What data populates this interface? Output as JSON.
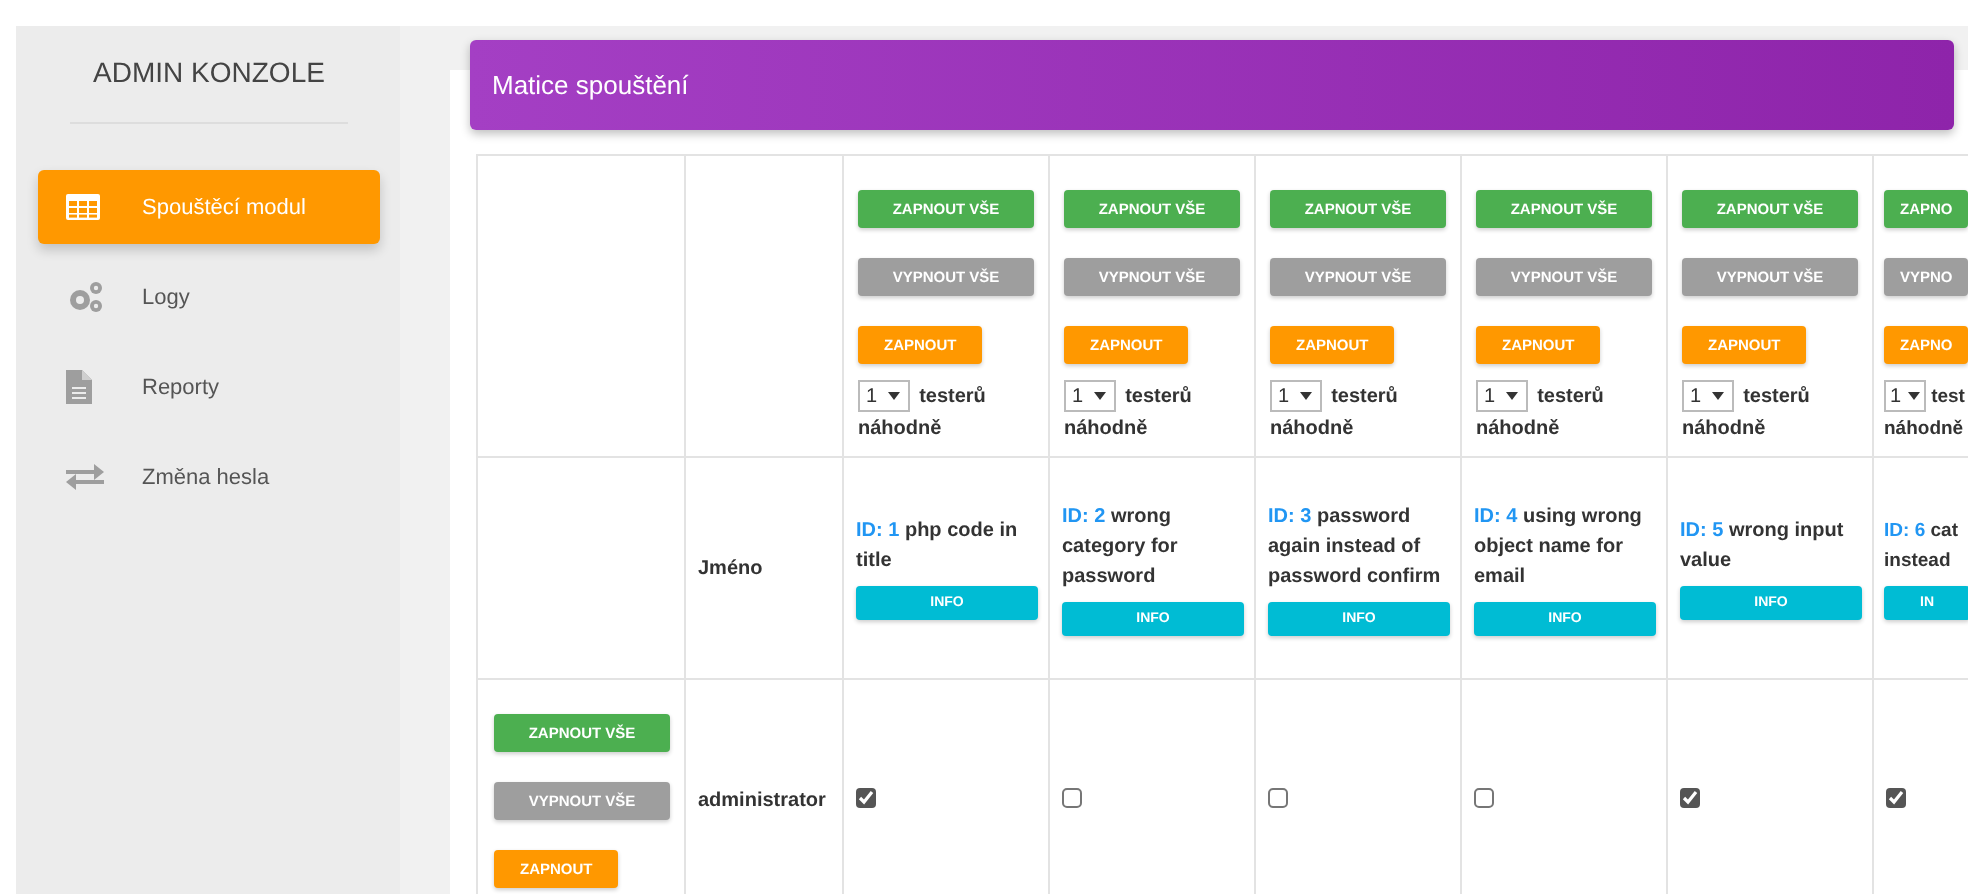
{
  "sidebar": {
    "title": "ADMIN KONZOLE",
    "items": [
      {
        "label": "Spouštěcí modul",
        "selected": true
      },
      {
        "label": "Logy",
        "selected": false
      },
      {
        "label": "Reporty",
        "selected": false
      },
      {
        "label": "Změna hesla",
        "selected": false
      }
    ]
  },
  "panel": {
    "title": "Matice spouštění"
  },
  "matrix": {
    "name_header": "Jméno",
    "tests": [
      {
        "enable_all": "ZAPNOUT VŠE",
        "disable_all": "VYPNOUT VŠE",
        "enable": "ZAPNOUT",
        "count": "1",
        "tester_label": "testerů",
        "random_label": "náhodně",
        "id_label": "ID:",
        "id": "1",
        "description": "php code in title",
        "info": "INFO"
      },
      {
        "enable_all": "ZAPNOUT VŠE",
        "disable_all": "VYPNOUT VŠE",
        "enable": "ZAPNOUT",
        "count": "1",
        "tester_label": "testerů",
        "random_label": "náhodně",
        "id_label": "ID:",
        "id": "2",
        "description": "wrong category for password",
        "info": "INFO"
      },
      {
        "enable_all": "ZAPNOUT VŠE",
        "disable_all": "VYPNOUT VŠE",
        "enable": "ZAPNOUT",
        "count": "1",
        "tester_label": "testerů",
        "random_label": "náhodně",
        "id_label": "ID:",
        "id": "3",
        "description": "password again instead of password confirm",
        "info": "INFO"
      },
      {
        "enable_all": "ZAPNOUT VŠE",
        "disable_all": "VYPNOUT VŠE",
        "enable": "ZAPNOUT",
        "count": "1",
        "tester_label": "testerů",
        "random_label": "náhodně",
        "id_label": "ID:",
        "id": "4",
        "description": "using wrong object name for email",
        "info": "INFO"
      },
      {
        "enable_all": "ZAPNOUT VŠE",
        "disable_all": "VYPNOUT VŠE",
        "enable": "ZAPNOUT",
        "count": "1",
        "tester_label": "testerů",
        "random_label": "náhodně",
        "id_label": "ID:",
        "id": "5",
        "description": "wrong input value",
        "info": "INFO"
      },
      {
        "enable_all": "ZAPNO",
        "disable_all": "VYPNO",
        "enable": "ZAPNO",
        "count": "1",
        "tester_label": "test",
        "random_label": "náhodně",
        "id_label": "ID:",
        "id": "6",
        "description": "cat\ninstead",
        "info": "IN"
      }
    ],
    "users": [
      {
        "name": "administrator",
        "enable_all": "ZAPNOUT VŠE",
        "disable_all": "VYPNOUT VŠE",
        "enable": "ZAPNOUT",
        "permissions": [
          {
            "checked": true
          },
          {
            "checked": false
          },
          {
            "checked": false
          },
          {
            "checked": false
          },
          {
            "checked": true
          },
          {
            "checked": true
          }
        ]
      }
    ]
  }
}
